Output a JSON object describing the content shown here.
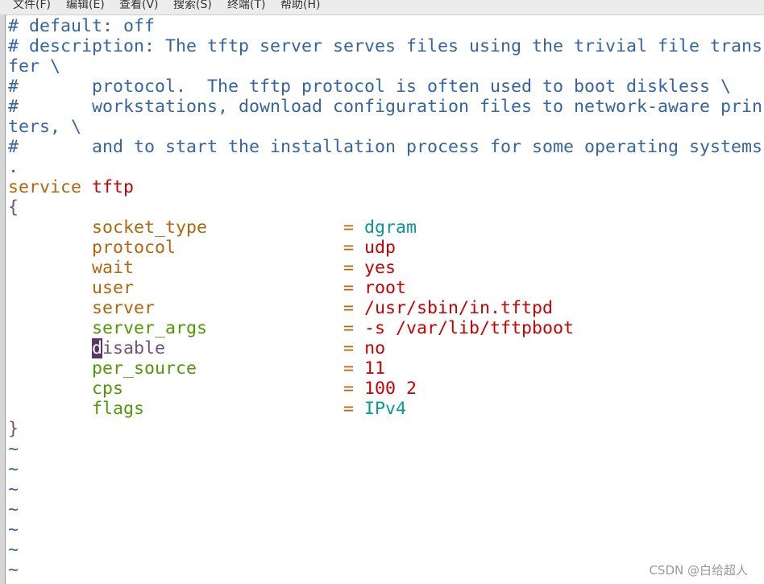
{
  "menu": [
    "文件(F)",
    "编辑(E)",
    "查看(V)",
    "搜索(S)",
    "终端(T)",
    "帮助(H)"
  ],
  "lines": [
    [
      [
        "c",
        "# default: off"
      ]
    ],
    [
      [
        "c",
        "# description: The tftp server serves files using the trivial file trans"
      ]
    ],
    [
      [
        "c",
        "fer \\"
      ]
    ],
    [
      [
        "c",
        "#       protocol.  The tftp protocol is often used to boot diskless \\"
      ]
    ],
    [
      [
        "c",
        "#       workstations, download configuration files to network-aware prin"
      ]
    ],
    [
      [
        "c",
        "ters, \\"
      ]
    ],
    [
      [
        "c",
        "#       and to start the installation process for some operating systems"
      ]
    ],
    [
      [
        "c",
        "."
      ]
    ],
    [
      [
        "k",
        "service "
      ],
      [
        "r",
        "tftp"
      ]
    ],
    [
      [
        "p",
        "{"
      ]
    ],
    [
      [
        "k",
        "        socket_type             "
      ],
      [
        "k",
        "= "
      ],
      [
        "t",
        "dgram"
      ]
    ],
    [
      [
        "k",
        "        protocol                "
      ],
      [
        "k",
        "= "
      ],
      [
        "r",
        "udp"
      ]
    ],
    [
      [
        "k",
        "        wait                    "
      ],
      [
        "k",
        "= "
      ],
      [
        "r",
        "yes"
      ]
    ],
    [
      [
        "k",
        "        user                    "
      ],
      [
        "k",
        "= "
      ],
      [
        "r",
        "root"
      ]
    ],
    [
      [
        "k",
        "        server                  "
      ],
      [
        "k",
        "= "
      ],
      [
        "r",
        "/usr/sbin/in.tftpd"
      ]
    ],
    [
      [
        "g",
        "        server_args             "
      ],
      [
        "k",
        "= "
      ],
      [
        "r",
        "-s /var/lib/tftpboot"
      ]
    ],
    [
      [
        "p",
        "        "
      ],
      [
        "cur",
        "d"
      ],
      [
        "p",
        "isable                 "
      ],
      [
        "k",
        "= "
      ],
      [
        "r",
        "no"
      ]
    ],
    [
      [
        "g",
        "        per_source              "
      ],
      [
        "k",
        "= "
      ],
      [
        "r",
        "11"
      ]
    ],
    [
      [
        "g",
        "        cps                     "
      ],
      [
        "k",
        "= "
      ],
      [
        "r",
        "100 2"
      ]
    ],
    [
      [
        "g",
        "        flags                   "
      ],
      [
        "k",
        "= "
      ],
      [
        "t",
        "IPv4"
      ]
    ],
    [
      [
        "p",
        "}"
      ]
    ],
    [
      [
        "c",
        "~"
      ]
    ],
    [
      [
        "c",
        "~"
      ]
    ],
    [
      [
        "c",
        "~"
      ]
    ],
    [
      [
        "c",
        "~"
      ]
    ],
    [
      [
        "c",
        "~"
      ]
    ],
    [
      [
        "c",
        "~"
      ]
    ],
    [
      [
        "c",
        "~"
      ]
    ]
  ],
  "watermark": "CSDN @白给超人"
}
